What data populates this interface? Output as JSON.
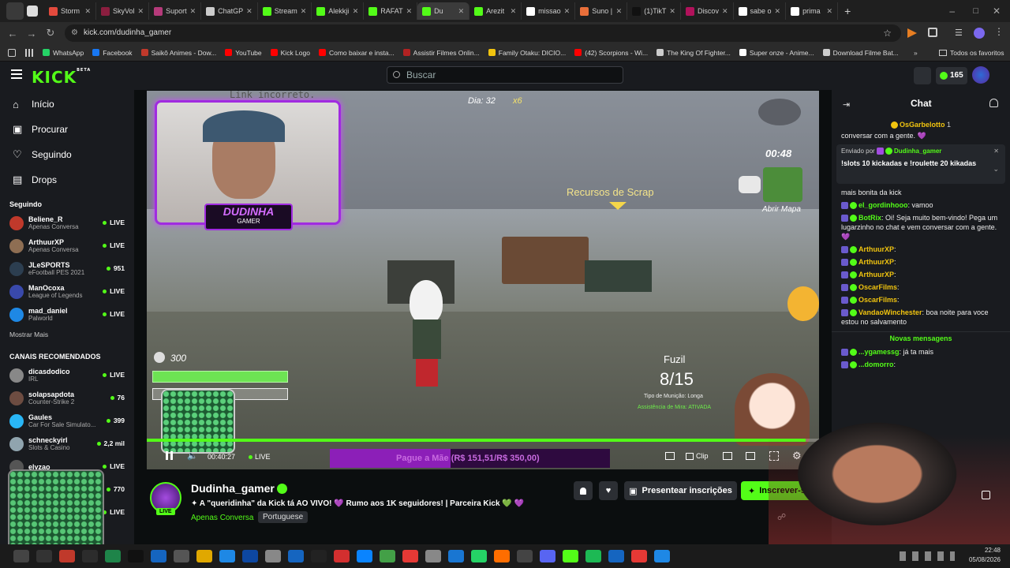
{
  "browser": {
    "tabs": [
      {
        "label": "Storm",
        "color": "#e34a3d"
      },
      {
        "label": "SkyVol",
        "color": "#8b1e3f"
      },
      {
        "label": "Suport",
        "color": "#b53a7a"
      },
      {
        "label": "ChatGP",
        "color": "#cccccc"
      },
      {
        "label": "Stream",
        "color": "#53fc18"
      },
      {
        "label": "Alekkji",
        "color": "#53fc18"
      },
      {
        "label": "RAFAT",
        "color": "#53fc18"
      },
      {
        "label": "Du",
        "color": "#53fc18"
      },
      {
        "label": "Arezit",
        "color": "#53fc18"
      },
      {
        "label": "missao",
        "color": "#ffffff"
      },
      {
        "label": "Suno |",
        "color": "#e96f3a"
      },
      {
        "label": "(1)TikT",
        "color": "#111111"
      },
      {
        "label": "Discov",
        "color": "#b1125b"
      },
      {
        "label": "sabe o",
        "color": "#ffffff"
      },
      {
        "label": "prima",
        "color": "#ffffff"
      }
    ],
    "url": "kick.com/dudinha_gamer",
    "bookmarks": [
      {
        "label": "WhatsApp",
        "color": "#25d366"
      },
      {
        "label": "Facebook",
        "color": "#1877f2"
      },
      {
        "label": "Saikô Animes - Dow...",
        "color": "#c0392b"
      },
      {
        "label": "YouTube",
        "color": "#ff0000"
      },
      {
        "label": "Kick Logo",
        "color": "#ff0000"
      },
      {
        "label": "Como baixar e insta...",
        "color": "#ff0000"
      },
      {
        "label": "Assistir Filmes Onlin...",
        "color": "#b22222"
      },
      {
        "label": "Family Otaku: DICIO...",
        "color": "#f1c40f"
      },
      {
        "label": "(42) Scorpions - Wi...",
        "color": "#ff0000"
      },
      {
        "label": "The King Of Fighter...",
        "color": "#cccccc"
      },
      {
        "label": "Super onze - Anime...",
        "color": "#ffffff"
      },
      {
        "label": "Download Filme Bat...",
        "color": "#cccccc"
      }
    ],
    "bookmarks_all": "Todos os favoritos"
  },
  "kick": {
    "logo": "KICK",
    "beta": "BETA",
    "search_placeholder": "Buscar",
    "points": "165"
  },
  "sidebar": {
    "nav": [
      {
        "label": "Início",
        "icon": "home-icon"
      },
      {
        "label": "Procurar",
        "icon": "browse-icon"
      },
      {
        "label": "Seguindo",
        "icon": "heart-icon"
      },
      {
        "label": "Drops",
        "icon": "drops-icon"
      }
    ],
    "following_title": "Seguindo",
    "following": [
      {
        "name": "Beliene_R",
        "sub": "Apenas Conversa",
        "status": "LIVE",
        "color": "#c0392b"
      },
      {
        "name": "ArthuurXP",
        "sub": "Apenas Conversa",
        "status": "LIVE",
        "color": "#8e6e53"
      },
      {
        "name": "JLeSPORTS",
        "sub": "eFootball PES 2021",
        "status": "951",
        "color": "#2c3e50"
      },
      {
        "name": "ManOcoxa",
        "sub": "League of Legends",
        "status": "LIVE",
        "color": "#3949ab"
      },
      {
        "name": "mad_daniel",
        "sub": "Palworld",
        "status": "LIVE",
        "color": "#1e88e5"
      }
    ],
    "show_more": "Mostrar Mais",
    "recommended_title": "CANAIS RECOMENDADOS",
    "recommended": [
      {
        "name": "dicasdodico",
        "sub": "IRL",
        "status": "LIVE",
        "color": "#888888"
      },
      {
        "name": "solapsapdota",
        "sub": "Counter-Strike 2",
        "status": "76",
        "color": "#6d4c41"
      },
      {
        "name": "Gaules",
        "sub": "Car For Sale Simulato...",
        "status": "399",
        "color": "#29b6f6"
      },
      {
        "name": "schneckyirl",
        "sub": "Slots & Casino",
        "status": "2,2 mil",
        "color": "#90a4ae"
      },
      {
        "name": "elyzao",
        "sub": "",
        "status": "LIVE",
        "color": "#555555"
      },
      {
        "name": "",
        "sub": "",
        "status": "770",
        "color": "#555555"
      },
      {
        "name": "",
        "sub": "",
        "status": "LIVE",
        "color": "#555555"
      }
    ]
  },
  "video": {
    "overlay_top": "Link incorreto.",
    "day": "Dia: 32",
    "multiplier": "x6",
    "timer": "00:48",
    "map_label": "Abrir Mapa",
    "objective": "Recursos de Scrap",
    "skull_count": "300",
    "weapon": "Fuzil",
    "ammo": "8/15",
    "ammo_type": "Tipo de Munição: Longa",
    "aim_assist": "Assistência de Mira: ATIVADA",
    "streamer_tag": "DUDINHA",
    "streamer_tag2": "GAMER",
    "goal_text": "Pague a Mãe (R$ 151,51/R$ 350,00)",
    "goal_progress": 0.43,
    "elapsed": "00:40:27",
    "live_label": "LIVE",
    "clip_label": "Clip",
    "progress": 0.98
  },
  "stream": {
    "channel": "Dudinha_gamer",
    "title": "✦ A \"queridinha\" da Kick tá AO VIVO! 💜 Rumo aos 1K seguidores! | Parceira Kick 💚 💜",
    "category": "Apenas Conversa",
    "language": "Portuguese",
    "live_badge": "LIVE",
    "gift_label": "Presentear inscrições",
    "subscribe_label": "Inscrever-se"
  },
  "chat": {
    "title": "Chat",
    "pinned_top_user": "OsGarbelotto",
    "pinned_top_count": "1",
    "pinned_sender_prefix": "Enviado por",
    "pinned_sender": "Dudinha_gamer",
    "pinned_text": "!slots 10 kickadas e !roulette 20 kikadas",
    "cut_top": "conversar com a gente. 💜",
    "cut_top2": "mais bonita da kick",
    "messages": [
      {
        "user": "el_gordinhooo",
        "color": "#53fc18",
        "text": ": vamoo"
      },
      {
        "user": "BotRix",
        "color": "#53fc18",
        "text": ": Oi! Seja muito bem-vindo! Pega um lugarzinho no chat e vem conversar com a gente. 💜"
      },
      {
        "user": "ArthuurXP",
        "color": "#f1c40f",
        "text": ":"
      },
      {
        "user": "ArthuurXP",
        "color": "#f1c40f",
        "text": ":"
      },
      {
        "user": "ArthuurXP",
        "color": "#f1c40f",
        "text": ":"
      },
      {
        "user": "OscarFilms",
        "color": "#f1c40f",
        "text": ":"
      },
      {
        "user": "OscarFilms",
        "color": "#f1c40f",
        "text": ":"
      },
      {
        "user": "VandaoWinchester",
        "color": "#f1c40f",
        "text": ": boa noite para voce estou no salvamento"
      }
    ],
    "new_messages": "Novas mensagens",
    "after_new": [
      {
        "user": "...ygamessg",
        "color": "#53fc18",
        "text": ": já ta mais"
      },
      {
        "user": "...domorro",
        "color": "#53fc18",
        "text": ":"
      }
    ]
  },
  "taskbar": {
    "time": "22:48",
    "date": "05/08/2026"
  }
}
